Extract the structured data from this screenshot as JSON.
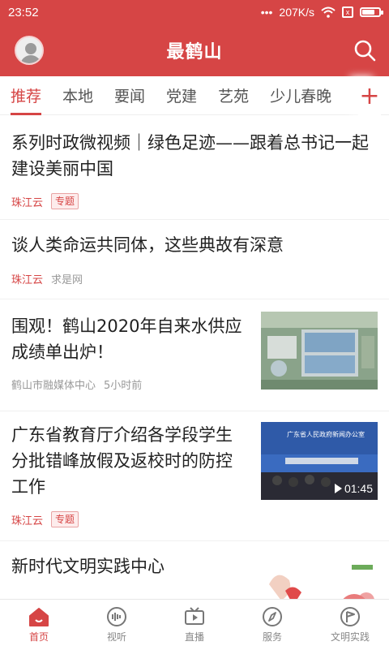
{
  "status": {
    "time": "23:52",
    "dots": "•••",
    "speed": "207K/s",
    "sim": "x"
  },
  "header": {
    "title": "最鹤山"
  },
  "tabs": [
    {
      "label": "推荐"
    },
    {
      "label": "本地"
    },
    {
      "label": "要闻"
    },
    {
      "label": "党建"
    },
    {
      "label": "艺苑"
    },
    {
      "label": "少儿春晚"
    }
  ],
  "plus_label": "+",
  "feed": [
    {
      "title": "系列时政微视频｜绿色足迹——跟着总书记一起建设美丽中国",
      "source": "珠江云",
      "tag": "专题"
    },
    {
      "title": "谈人类命运共同体，这些典故有深意",
      "source": "珠江云",
      "extra": "求是网"
    },
    {
      "title": "围观！鹤山2020年自来水供应成绩单出炉！",
      "source": "鹤山市融媒体中心",
      "extra": "5小时前",
      "thumb": "aerial-water-plant"
    },
    {
      "title": "广东省教育厅介绍各学段学生分批错峰放假及返校时的防控工作",
      "source": "珠江云",
      "tag": "专题",
      "thumb": "press-conference",
      "thumb_banner": "广东省人民政府新闻办公室",
      "duration": "01:45"
    },
    {
      "title": "新时代文明实践中心",
      "thumb": "civilization-graphic"
    }
  ],
  "tabbar": [
    {
      "label": "首页",
      "icon": "home-icon"
    },
    {
      "label": "视听",
      "icon": "audio-icon"
    },
    {
      "label": "直播",
      "icon": "live-icon"
    },
    {
      "label": "服务",
      "icon": "compass-icon"
    },
    {
      "label": "文明实践",
      "icon": "flag-icon"
    }
  ],
  "colors": {
    "brand": "#d64545",
    "text": "#222222",
    "muted": "#999999"
  }
}
